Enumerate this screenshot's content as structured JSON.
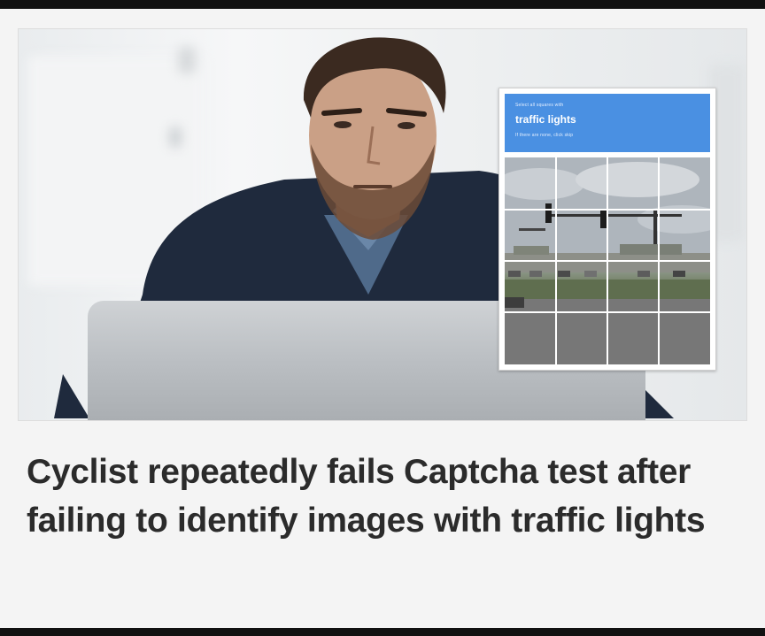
{
  "captcha": {
    "instruction_top": "Select all squares with",
    "target": "traffic lights",
    "instruction_bottom": "If there are none, click skip"
  },
  "headline": "Cyclist repeatedly fails Captcha test after failing to identify images with traffic lights"
}
